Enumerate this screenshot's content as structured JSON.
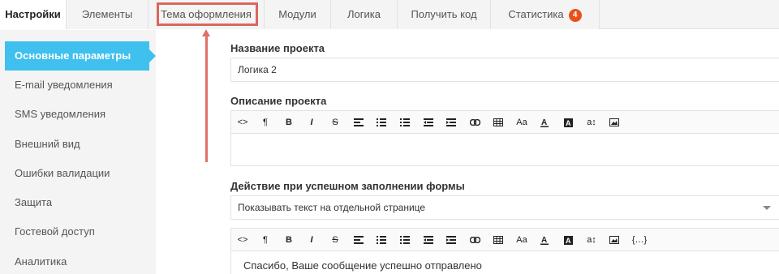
{
  "tabs": [
    {
      "label": "Настройки"
    },
    {
      "label": "Элементы"
    },
    {
      "label": "Тема оформления"
    },
    {
      "label": "Модули"
    },
    {
      "label": "Логика"
    },
    {
      "label": "Получить код"
    },
    {
      "label": "Статистика",
      "badge": "4"
    }
  ],
  "sidebar": {
    "items": [
      {
        "label": "Основные параметры"
      },
      {
        "label": "E-mail уведомления"
      },
      {
        "label": "SMS уведомления"
      },
      {
        "label": "Внешний вид"
      },
      {
        "label": "Ошибки валидации"
      },
      {
        "label": "Защита"
      },
      {
        "label": "Гостевой доступ"
      },
      {
        "label": "Аналитика"
      }
    ]
  },
  "form": {
    "project_name_label": "Название проекта",
    "project_name_value": "Логика 2",
    "description_label": "Описание проекта",
    "description_value": "",
    "success_action_label": "Действие при успешном заполнении формы",
    "success_action_value": "Показывать текст на отдельной странице",
    "success_message": "Спасибо, Ваше сообщение успешно отправлено"
  },
  "toolbar": {
    "code_label": "<>",
    "paragraph_label": "¶",
    "bold_label": "B",
    "italic_label": "I",
    "strike_label": "S",
    "fontsize_label": "Aa",
    "lineheight_label": "a↕",
    "variable_label": "{…}"
  },
  "colors": {
    "accent": "#3fc0ee",
    "badge": "#e8521a",
    "highlight": "#d9675e"
  }
}
